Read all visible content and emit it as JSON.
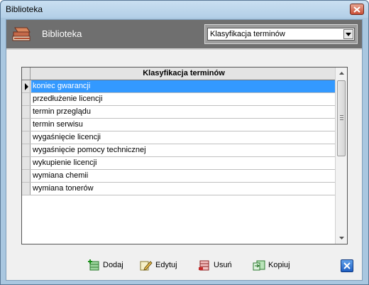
{
  "window": {
    "title": "Biblioteka"
  },
  "header": {
    "title": "Biblioteka",
    "dropdown_value": "Klasyfikacja terminów"
  },
  "grid": {
    "column_header": "Klasyfikacja terminów",
    "rows": [
      "koniec gwarancji",
      "przedłużenie licencji",
      "termin przeglądu",
      "termin serwisu",
      "wygaśnięcie licencji",
      "wygaśnięcie pomocy technicznej",
      "wykupienie licencji",
      "wymiana chemii",
      "wymiana tonerów"
    ],
    "selected_index": 0
  },
  "toolbar": {
    "add_label": "Dodaj",
    "edit_label": "Edytuj",
    "delete_label": "Usuń",
    "copy_label": "Kopiuj"
  },
  "colors": {
    "selection": "#3399ff",
    "header_bg": "#6f6f6f",
    "window_frame": "#a9c7e0"
  },
  "icons": {
    "header": "books-icon",
    "add": "add-record-icon",
    "edit": "edit-pencil-icon",
    "delete": "delete-record-icon",
    "copy": "copy-record-icon",
    "exit": "exit-x-icon"
  }
}
